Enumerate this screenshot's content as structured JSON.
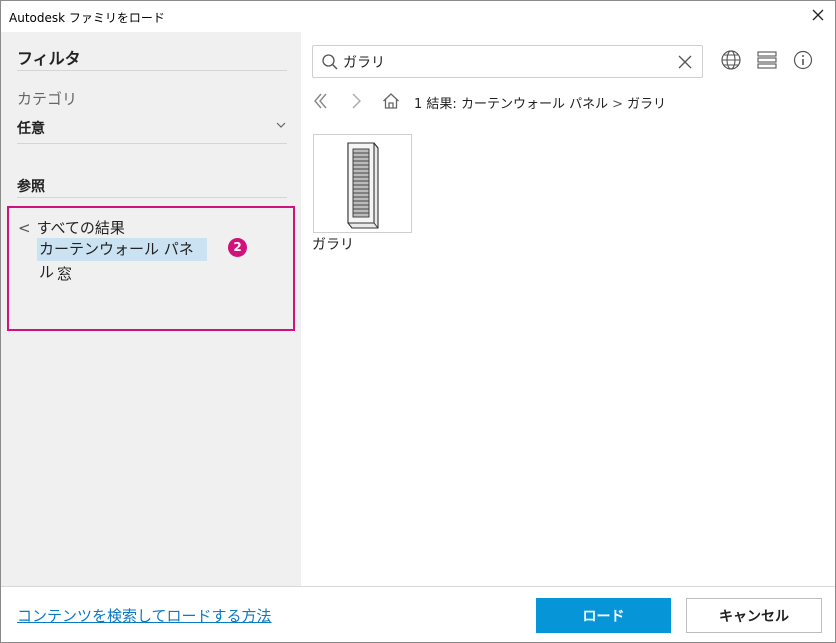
{
  "window": {
    "title": "Autodesk ファミリをロード"
  },
  "filter": {
    "title": "フィルタ",
    "category_label": "カテゴリ",
    "category_value": "任意",
    "browse_title": "参照",
    "all_results": "すべての結果",
    "selected_item": "カーテンウォール パネル",
    "sub_item": "窓",
    "badge": "2",
    "highlight_color": "#d1127c"
  },
  "search": {
    "value": "ガラリ",
    "placeholder": ""
  },
  "toolbar": {
    "icons": [
      "globe-icon",
      "list-view-icon",
      "info-icon"
    ]
  },
  "breadcrumb": {
    "count": "1 結果:",
    "path_1": "カーテンウォール パネル",
    "separator": ">",
    "path_2": "ガラリ"
  },
  "results": [
    {
      "label": "ガラリ",
      "icon": "louver-thumbnail"
    }
  ],
  "footer": {
    "help_link": "コンテンツを検索してロードする方法",
    "load_label": "ロード",
    "cancel_label": "キャンセル",
    "primary_color": "#0696d7"
  }
}
